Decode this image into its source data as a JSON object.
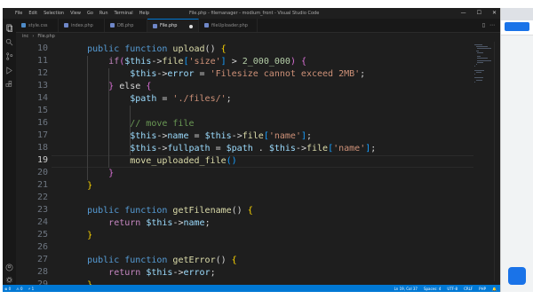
{
  "titlebar": {
    "menu": [
      "File",
      "Edit",
      "Selection",
      "View",
      "Go",
      "Run",
      "Terminal",
      "Help"
    ],
    "window_title": "File.php - filemanager - modium_front - Visual Studio Code",
    "controls": {
      "minimize": "—",
      "maximize": "☐",
      "close": "✕"
    }
  },
  "tabs": [
    {
      "label": "style.css",
      "active": false
    },
    {
      "label": "index.php",
      "active": false
    },
    {
      "label": "DB.php",
      "active": false
    },
    {
      "label": "File.php",
      "active": true,
      "modified": true
    },
    {
      "label": "fileUploader.php",
      "active": false
    }
  ],
  "breadcrumb": {
    "folder": "inc",
    "file": "File.php"
  },
  "editor": {
    "current_line": 19,
    "lines": [
      {
        "n": "10",
        "tokens": [
          [
            "    ",
            ""
          ],
          [
            "public function ",
            "kw"
          ],
          [
            "upload",
            "fn"
          ],
          [
            "() ",
            ""
          ],
          [
            "{",
            "br1"
          ]
        ]
      },
      {
        "n": "11",
        "tokens": [
          [
            "        ",
            ""
          ],
          [
            "if",
            "ctl"
          ],
          [
            "(",
            "br2"
          ],
          [
            "$this",
            "vr"
          ],
          [
            "->",
            ""
          ],
          [
            "file",
            "fn"
          ],
          [
            "[",
            "br3"
          ],
          [
            "'size'",
            "str"
          ],
          [
            "]",
            "br3"
          ],
          [
            " > ",
            ""
          ],
          [
            "2_000_000",
            "num"
          ],
          [
            ")",
            "br2"
          ],
          [
            " ",
            ""
          ],
          [
            "{",
            "br2"
          ]
        ]
      },
      {
        "n": "12",
        "tokens": [
          [
            "            ",
            ""
          ],
          [
            "$this",
            "vr"
          ],
          [
            "->",
            ""
          ],
          [
            "error",
            "vr"
          ],
          [
            " = ",
            ""
          ],
          [
            "'Filesize cannot exceed 2MB'",
            "str"
          ],
          [
            ";",
            ""
          ]
        ]
      },
      {
        "n": "13",
        "tokens": [
          [
            "        ",
            ""
          ],
          [
            "}",
            "br2"
          ],
          [
            " else ",
            ""
          ],
          [
            "{",
            "br2"
          ]
        ]
      },
      {
        "n": "14",
        "tokens": [
          [
            "            ",
            ""
          ],
          [
            "$path",
            "vr"
          ],
          [
            " = ",
            ""
          ],
          [
            "'./files/'",
            "str"
          ],
          [
            ";",
            ""
          ]
        ]
      },
      {
        "n": "15",
        "tokens": [
          [
            "",
            ""
          ]
        ]
      },
      {
        "n": "16",
        "tokens": [
          [
            "            ",
            ""
          ],
          [
            "// move file",
            "cm"
          ]
        ]
      },
      {
        "n": "17",
        "tokens": [
          [
            "            ",
            ""
          ],
          [
            "$this",
            "vr"
          ],
          [
            "->",
            ""
          ],
          [
            "name",
            "vr"
          ],
          [
            " = ",
            ""
          ],
          [
            "$this",
            "vr"
          ],
          [
            "->",
            ""
          ],
          [
            "file",
            "fn"
          ],
          [
            "[",
            "br3"
          ],
          [
            "'name'",
            "str"
          ],
          [
            "]",
            "br3"
          ],
          [
            ";",
            ""
          ]
        ]
      },
      {
        "n": "18",
        "tokens": [
          [
            "            ",
            ""
          ],
          [
            "$this",
            "vr"
          ],
          [
            "->",
            ""
          ],
          [
            "fullpath",
            "vr"
          ],
          [
            " = ",
            ""
          ],
          [
            "$path",
            "vr"
          ],
          [
            " . ",
            ""
          ],
          [
            "$this",
            "vr"
          ],
          [
            "->",
            ""
          ],
          [
            "file",
            "fn"
          ],
          [
            "[",
            "br3"
          ],
          [
            "'name'",
            "str"
          ],
          [
            "]",
            "br3"
          ],
          [
            ";",
            ""
          ]
        ]
      },
      {
        "n": "19",
        "tokens": [
          [
            "            ",
            ""
          ],
          [
            "move_uploaded_file",
            "fn"
          ],
          [
            "()",
            "br3"
          ]
        ]
      },
      {
        "n": "20",
        "tokens": [
          [
            "        ",
            ""
          ],
          [
            "}",
            "br2"
          ]
        ]
      },
      {
        "n": "21",
        "tokens": [
          [
            "    ",
            ""
          ],
          [
            "}",
            "br1"
          ]
        ]
      },
      {
        "n": "22",
        "tokens": [
          [
            "",
            ""
          ]
        ]
      },
      {
        "n": "23",
        "tokens": [
          [
            "    ",
            ""
          ],
          [
            "public function ",
            "kw"
          ],
          [
            "getFilename",
            "fn"
          ],
          [
            "() ",
            ""
          ],
          [
            "{",
            "br1"
          ]
        ]
      },
      {
        "n": "24",
        "tokens": [
          [
            "        ",
            ""
          ],
          [
            "return ",
            "ctl"
          ],
          [
            "$this",
            "vr"
          ],
          [
            "->",
            ""
          ],
          [
            "name",
            "vr"
          ],
          [
            ";",
            ""
          ]
        ]
      },
      {
        "n": "25",
        "tokens": [
          [
            "    ",
            ""
          ],
          [
            "}",
            "br1"
          ]
        ]
      },
      {
        "n": "26",
        "tokens": [
          [
            "",
            ""
          ]
        ]
      },
      {
        "n": "27",
        "tokens": [
          [
            "    ",
            ""
          ],
          [
            "public function ",
            "kw"
          ],
          [
            "getError",
            "fn"
          ],
          [
            "() ",
            ""
          ],
          [
            "{",
            "br1"
          ]
        ]
      },
      {
        "n": "28",
        "tokens": [
          [
            "        ",
            ""
          ],
          [
            "return ",
            "ctl"
          ],
          [
            "$this",
            "vr"
          ],
          [
            "->",
            ""
          ],
          [
            "error",
            "vr"
          ],
          [
            ";",
            ""
          ]
        ]
      },
      {
        "n": "29",
        "tokens": [
          [
            "    ",
            ""
          ],
          [
            "}",
            "br1"
          ]
        ]
      }
    ]
  },
  "statusbar": {
    "left": [
      "⊗ 0",
      "⚠ 0",
      "⚡ 1"
    ],
    "right": [
      "Ln 19, Col 37",
      "Spaces: 4",
      "UTF-8",
      "CRLF",
      "PHP",
      "🔔"
    ]
  },
  "colors": {
    "accent": "#0078d4",
    "editor_bg": "#1e1e1e"
  }
}
